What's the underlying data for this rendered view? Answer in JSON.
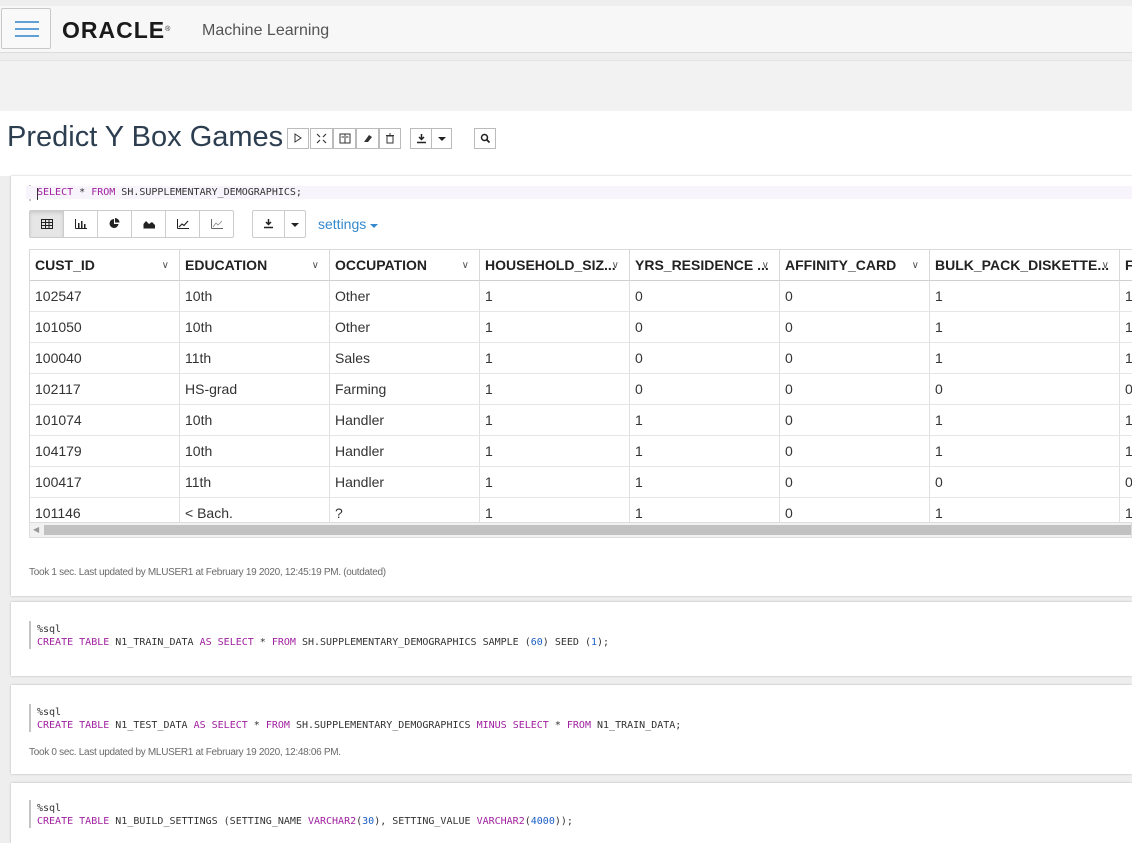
{
  "header": {
    "logo_text": "ORACLE",
    "logo_mark": "®",
    "app_name": "Machine Learning"
  },
  "notebook": {
    "title": "Predict Y Box Games",
    "toolbar_icons": [
      "run-all-icon",
      "hide-code-icon",
      "book-icon",
      "eraser-icon",
      "trash-icon",
      "download-icon",
      "dropdown-icon",
      "search-icon"
    ]
  },
  "paragraph1": {
    "code_prefix_kw": "SELECT",
    "code_star": " * ",
    "code_from": "FROM",
    "code_rest": " SH.SUPPLEMENTARY_DEMOGRAPHICS;",
    "viz_icons": [
      "table-icon",
      "bar-chart-icon",
      "pie-chart-icon",
      "area-chart-icon",
      "line-chart-icon",
      "scatter-chart-icon"
    ],
    "settings_label": "settings",
    "table": {
      "columns": [
        "CUST_ID",
        "EDUCATION",
        "OCCUPATION",
        "HOUSEHOLD_SIZ...",
        "YRS_RESIDENCE ...",
        "AFFINITY_CARD",
        "BULK_PACK_DISKETTE...",
        "F"
      ],
      "rows": [
        [
          "102547",
          "10th",
          "Other",
          "1",
          "0",
          "0",
          "1",
          "1"
        ],
        [
          "101050",
          "10th",
          "Other",
          "1",
          "0",
          "0",
          "1",
          "1"
        ],
        [
          "100040",
          "11th",
          "Sales",
          "1",
          "0",
          "0",
          "1",
          "1"
        ],
        [
          "102117",
          "HS-grad",
          "Farming",
          "1",
          "0",
          "0",
          "0",
          "0"
        ],
        [
          "101074",
          "10th",
          "Handler",
          "1",
          "1",
          "0",
          "1",
          "1"
        ],
        [
          "104179",
          "10th",
          "Handler",
          "1",
          "1",
          "0",
          "1",
          "1"
        ],
        [
          "100417",
          "11th",
          "Handler",
          "1",
          "1",
          "0",
          "0",
          "0"
        ],
        [
          "101146",
          "< Bach.",
          "?",
          "1",
          "1",
          "0",
          "1",
          "1"
        ]
      ]
    },
    "status": "Took 1 sec. Last updated by MLUSER1 at February 19 2020, 12:45:19 PM. (outdated)"
  },
  "paragraph2": {
    "interpreter": "%sql",
    "t1": "CREATE",
    "t2": " ",
    "t3": "TABLE",
    "t4": " N1_TRAIN_DATA ",
    "t5": "AS",
    "t6": " ",
    "t7": "SELECT",
    "t8": " * ",
    "t9": "FROM",
    "t10": " SH.SUPPLEMENTARY_DEMOGRAPHICS SAMPLE (",
    "t11": "60",
    "t12": ") SEED (",
    "t13": "1",
    "t14": ");"
  },
  "paragraph3": {
    "interpreter": "%sql",
    "t1": "CREATE",
    "t2": " ",
    "t3": "TABLE",
    "t4": " N1_TEST_DATA ",
    "t5": "AS",
    "t6": " ",
    "t7": "SELECT",
    "t8": " * ",
    "t9": "FROM",
    "t10": " SH.SUPPLEMENTARY_DEMOGRAPHICS ",
    "t11": "MINUS",
    "t12": " ",
    "t13": "SELECT",
    "t14": " * ",
    "t15": "FROM",
    "t16": " N1_TRAIN_DATA;",
    "status": "Took 0 sec. Last updated by MLUSER1 at February 19 2020, 12:48:06 PM."
  },
  "paragraph4": {
    "interpreter": "%sql",
    "t1": "CREATE",
    "t2": " ",
    "t3": "TABLE",
    "t4": " N1_BUILD_SETTINGS (SETTING_NAME ",
    "t5": "VARCHAR2",
    "t6": "(",
    "t7": "30",
    "t8": "), SETTING_VALUE ",
    "t9": "VARCHAR2",
    "t10": "(",
    "t11": "4000",
    "t12": "));"
  }
}
